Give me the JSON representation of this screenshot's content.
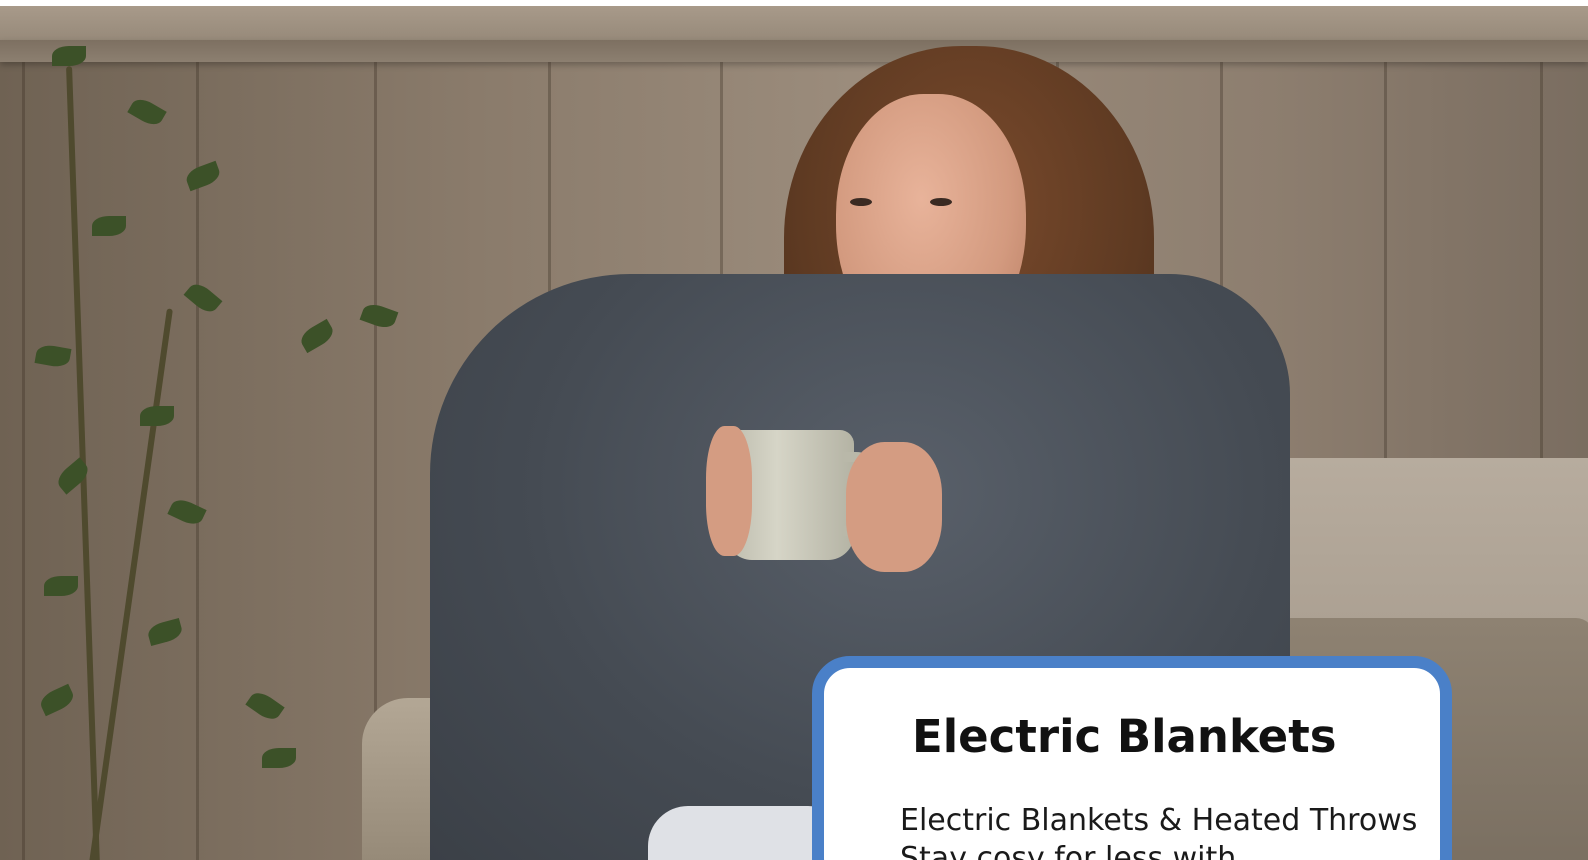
{
  "hero": {
    "image_alt": "Woman wrapped in a grey electric blanket holding a mug on a sofa"
  },
  "promo_card": {
    "title": "Electric Blankets",
    "description": "Electric Blankets & Heated Throws Stay cosy for less with",
    "border_color": "#4a80c8"
  }
}
